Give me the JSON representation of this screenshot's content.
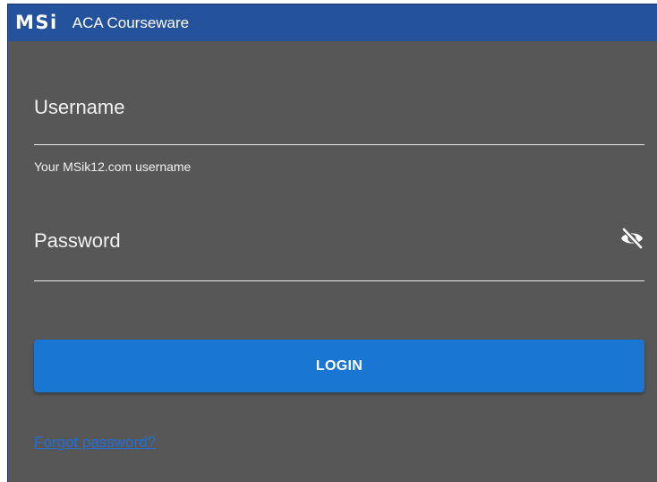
{
  "header": {
    "logo": "MSi",
    "title": "ACA Courseware"
  },
  "form": {
    "username": {
      "label": "Username",
      "value": "",
      "helper": "Your MSik12.com username"
    },
    "password": {
      "label": "Password",
      "value": "",
      "toggle_icon": "eye-off-icon"
    },
    "login_label": "LOGIN",
    "forgot_label": "Forgot password?"
  },
  "colors": {
    "header_bg": "#24529c",
    "panel_bg": "#575757",
    "button_bg": "#1976d2",
    "link": "#1f6fd6"
  }
}
